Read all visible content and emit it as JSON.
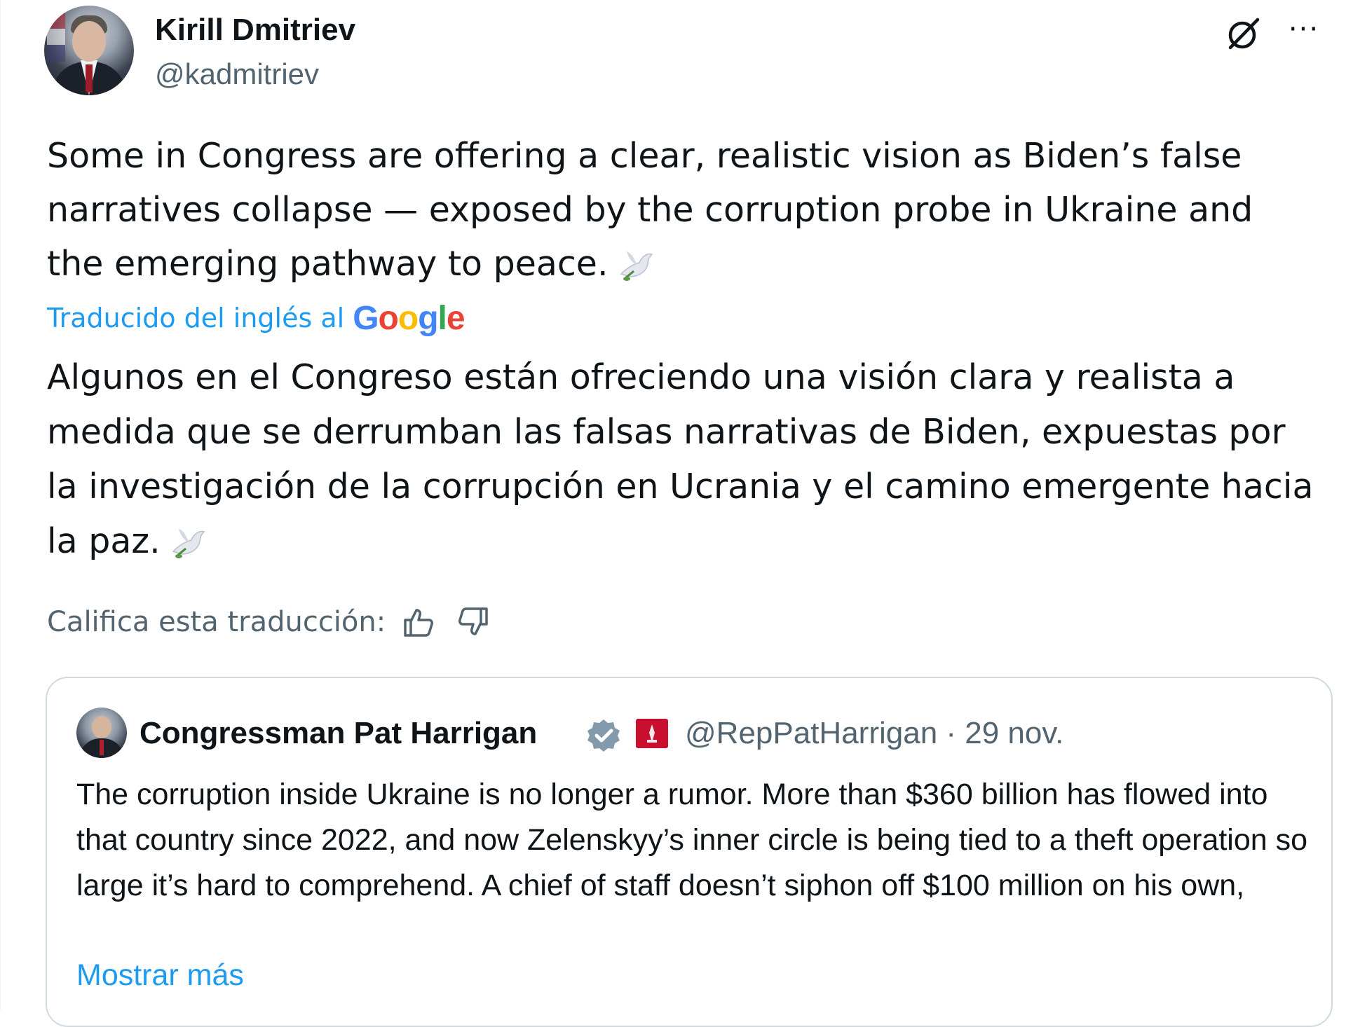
{
  "author": {
    "name": "Kirill Dmitriev",
    "handle": "@kadmitriev"
  },
  "tweet": {
    "original_text": "Some in Congress are offering a clear, realistic vision as Biden’s false narratives collapse — exposed by the corruption probe in Ukraine and the emerging pathway to peace.",
    "translated_by_label": "Traducido del inglés al",
    "translator_brand": "Google",
    "translated_text": "Algunos en el Congreso están ofreciendo una visión clara y realista a medida que se derrumban las falsas narrativas de Biden, expuestas por la investigación de la corrupción en Ucrania y el camino emergente hacia la paz.",
    "rate_label": "Califica esta traducción:"
  },
  "quoted_tweet": {
    "name": "Congressman Pat Harrigan",
    "handle_and_date": "@RepPatHarrigan · 29 nov.",
    "text": "The corruption inside Ukraine is no longer a rumor. More than $360 billion has flowed into that country since 2022, and now Zelenskyy’s inner circle is being tied to a theft operation so large it’s hard to comprehend. A chief of staff doesn’t siphon off $100 million on his own,",
    "show_more": "Mostrar más"
  },
  "icons": {
    "grok": "grok-icon",
    "more": "more-options-icon",
    "thumbs_up": "thumbs-up-icon",
    "thumbs_down": "thumbs-down-icon",
    "verified": "verified-badge-icon",
    "affiliate": "affiliate-flag-icon",
    "dove": "dove-icon"
  },
  "colors": {
    "text": "#0f1419",
    "secondary": "#536471",
    "link": "#1d9bf0",
    "border": "#cfd9de",
    "verified_gray": "#829aab"
  }
}
